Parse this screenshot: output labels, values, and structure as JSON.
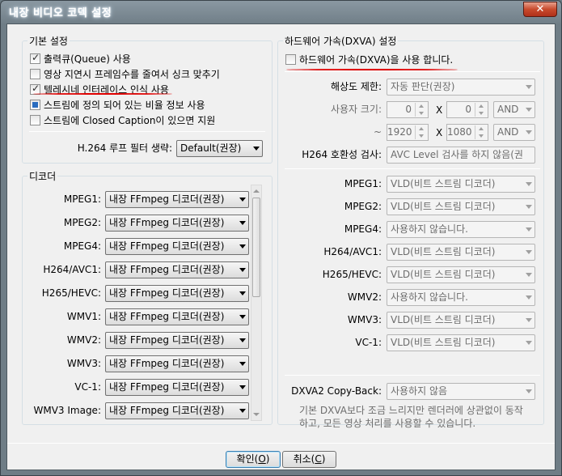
{
  "window": {
    "title": "내장 비디오 코덱 설정",
    "close_glyph": "✕"
  },
  "basic": {
    "legend": "기본 설정",
    "checkboxes": [
      {
        "label": "출력큐(Queue) 사용",
        "state": "checked"
      },
      {
        "label": "영상 지연시 프레임수를 줄여서 싱크 맞추기",
        "state": "unchecked"
      },
      {
        "label": "텔레시네 인터레이스 인식 사용",
        "state": "checked"
      },
      {
        "label": "스트림에 정의 되어 있는 비율 정보 사용",
        "state": "indeterminate"
      },
      {
        "label": "스트림에 Closed Caption이 있으면 지원",
        "state": "unchecked"
      }
    ],
    "loop_filter_label": "H.264 루프 필터 생략:",
    "loop_filter_value": "Default(권장)"
  },
  "decoder": {
    "legend": "디코더",
    "rows": [
      {
        "label": "MPEG1:",
        "value": "내장 FFmpeg 디코더(권장)"
      },
      {
        "label": "MPEG2:",
        "value": "내장 FFmpeg 디코더(권장)"
      },
      {
        "label": "MPEG4:",
        "value": "내장 FFmpeg 디코더(권장)"
      },
      {
        "label": "H264/AVC1:",
        "value": "내장 FFmpeg 디코더(권장)"
      },
      {
        "label": "H265/HEVC:",
        "value": "내장 FFmpeg 디코더(권장)"
      },
      {
        "label": "WMV1:",
        "value": "내장 FFmpeg 디코더(권장)"
      },
      {
        "label": "WMV2:",
        "value": "내장 FFmpeg 디코더(권장)"
      },
      {
        "label": "WMV3:",
        "value": "내장 FFmpeg 디코더(권장)"
      },
      {
        "label": "VC-1:",
        "value": "내장 FFmpeg 디코더(권장)"
      },
      {
        "label": "WMV3 Image:",
        "value": "내장 FFmpeg 디코더(권장)"
      }
    ]
  },
  "dxva": {
    "legend": "하드웨어 가속(DXVA) 설정",
    "enable_label": "하드웨어 가속(DXVA)을 사용 합니다.",
    "resolution_label": "해상도 제한:",
    "resolution_value": "자동 판단(권장)",
    "custom_size_label": "사용자 크기:",
    "min_w": "0",
    "min_h": "0",
    "min_op": "AND",
    "tilde": "~",
    "max_w": "1920",
    "max_h": "1080",
    "max_op": "AND",
    "x_glyph": "X",
    "compat_label": "H264 호환성 검사:",
    "compat_value": "AVC Level 검사를 하지 않음(권",
    "rows": [
      {
        "label": "MPEG1:",
        "value": "VLD(비트 스트림 디코더)"
      },
      {
        "label": "MPEG2:",
        "value": "VLD(비트 스트림 디코더)"
      },
      {
        "label": "MPEG4:",
        "value": "사용하지 않습니다."
      },
      {
        "label": "H264/AVC1:",
        "value": "VLD(비트 스트림 디코더)"
      },
      {
        "label": "H265/HEVC:",
        "value": "VLD(비트 스트림 디코더)"
      },
      {
        "label": "WMV2:",
        "value": "사용하지 않습니다."
      },
      {
        "label": "WMV3:",
        "value": "VLD(비트 스트림 디코더)"
      },
      {
        "label": "VC-1:",
        "value": "VLD(비트 스트림 디코더)"
      }
    ],
    "copyback_label": "DXVA2 Copy-Back:",
    "copyback_value": "사용하지 않음",
    "note_line1": "기본 DXVA보다 조금 느리지만 렌더러에 상관없이 동작",
    "note_line2": "하고, 모든 영상 처리를 사용할 수 있습니다."
  },
  "buttons": {
    "ok_label": "확인",
    "ok_key": "O",
    "cancel_label": "취소",
    "cancel_key": "C"
  }
}
